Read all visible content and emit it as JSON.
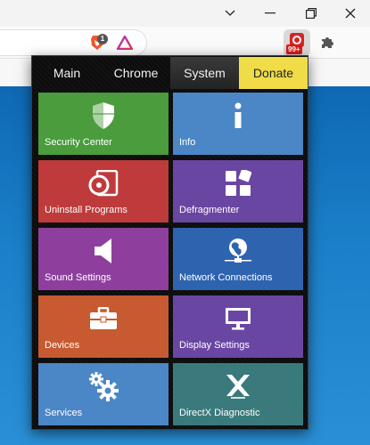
{
  "browser": {
    "brave_shield_count": "1",
    "extension_badge": "99+"
  },
  "popup": {
    "tabs": [
      {
        "label": "Main"
      },
      {
        "label": "Chrome"
      },
      {
        "label": "System",
        "selected": true
      },
      {
        "label": "Donate"
      }
    ],
    "tiles": [
      {
        "label": "Security Center",
        "color": "#4a9c3c",
        "icon": "shield-icon"
      },
      {
        "label": "Info",
        "color": "#4b86c6",
        "icon": "info-icon"
      },
      {
        "label": "Uninstall Programs",
        "color": "#bf3b3b",
        "icon": "disc-icon"
      },
      {
        "label": "Defragmenter",
        "color": "#6a46a3",
        "icon": "blocks-icon"
      },
      {
        "label": "Sound Settings",
        "color": "#8e3f9e",
        "icon": "speaker-icon"
      },
      {
        "label": "Network Connections",
        "color": "#2e63b0",
        "icon": "network-icon"
      },
      {
        "label": "Devices",
        "color": "#c75a30",
        "icon": "toolbox-icon"
      },
      {
        "label": "Display Settings",
        "color": "#6a46a3",
        "icon": "monitor-icon"
      },
      {
        "label": "Services",
        "color": "#4b86c6",
        "icon": "gears-icon"
      },
      {
        "label": "DirectX Diagnostic",
        "color": "#3a7a7c",
        "icon": "directx-icon"
      }
    ]
  }
}
